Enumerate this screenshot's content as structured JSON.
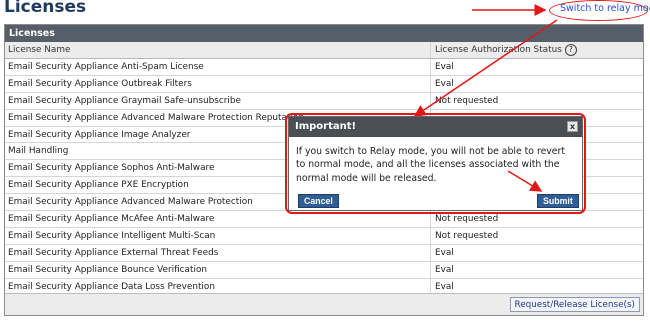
{
  "page": {
    "title": "Licenses"
  },
  "relay_link": {
    "label": "Switch to relay mode"
  },
  "panel": {
    "header": "Licenses",
    "columns": {
      "name": "License Name",
      "status": "License Authorization Status",
      "help": "?"
    },
    "rows": [
      {
        "name": "Email Security Appliance Anti-Spam License",
        "status": "Eval"
      },
      {
        "name": "Email Security Appliance Outbreak Filters",
        "status": "Eval"
      },
      {
        "name": "Email Security Appliance Graymail Safe-unsubscribe",
        "status": "Not requested"
      },
      {
        "name": "Email Security Appliance Advanced Malware Protection Reputation",
        "status": ""
      },
      {
        "name": "Email Security Appliance Image Analyzer",
        "status": ""
      },
      {
        "name": "Mail Handling",
        "status": ""
      },
      {
        "name": "Email Security Appliance Sophos Anti-Malware",
        "status": ""
      },
      {
        "name": "Email Security Appliance PXE Encryption",
        "status": ""
      },
      {
        "name": "Email Security Appliance Advanced Malware Protection",
        "status": ""
      },
      {
        "name": "Email Security Appliance McAfee Anti-Malware",
        "status": "Not requested"
      },
      {
        "name": "Email Security Appliance Intelligent Multi-Scan",
        "status": "Not requested"
      },
      {
        "name": "Email Security Appliance External Threat Feeds",
        "status": "Eval"
      },
      {
        "name": "Email Security Appliance Bounce Verification",
        "status": "Eval"
      },
      {
        "name": "Email Security Appliance Data Loss Prevention",
        "status": "Eval"
      }
    ],
    "footer_button": "Request/Release License(s)"
  },
  "modal": {
    "title": "Important!",
    "close": "x",
    "message": "If you switch to Relay mode, you will not be able to revert to normal mode, and all the licenses associated with the normal mode will be released.",
    "cancel_label": "Cancel",
    "submit_label": "Submit"
  },
  "colors": {
    "annotation": "#e01818",
    "header_bg": "#565e6a",
    "button_blue": "#2f5e97",
    "title_blue": "#1f3a5e"
  }
}
